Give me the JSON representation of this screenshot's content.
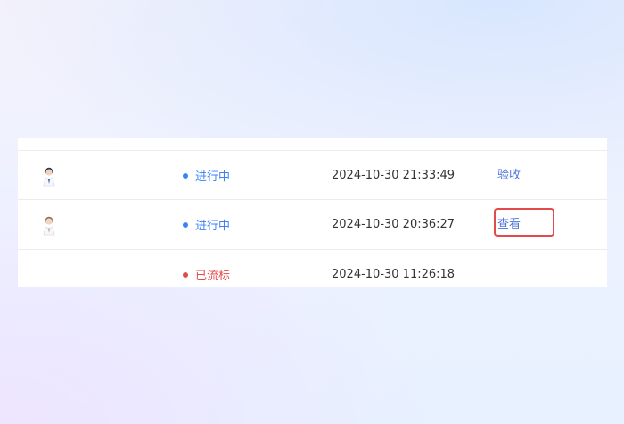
{
  "table": {
    "rows": [
      {
        "avatar": "doctor-avatar-icon",
        "status": {
          "label": "进行中",
          "color": "#3b82f6"
        },
        "time": "2024-10-30 21:33:49",
        "action": "验收"
      },
      {
        "avatar": "doctor-avatar-icon",
        "status": {
          "label": "进行中",
          "color": "#3b82f6"
        },
        "time": "2024-10-30 20:36:27",
        "action": "查看"
      },
      {
        "avatar": "",
        "status": {
          "label": "已流标",
          "color": "#e24b4b"
        },
        "time": "2024-10-30 11:26:18",
        "action": ""
      }
    ]
  },
  "colors": {
    "link": "#4a74d6",
    "in_progress": "#3b82f6",
    "failed": "#e24b4b",
    "highlight": "#e24b4b"
  }
}
